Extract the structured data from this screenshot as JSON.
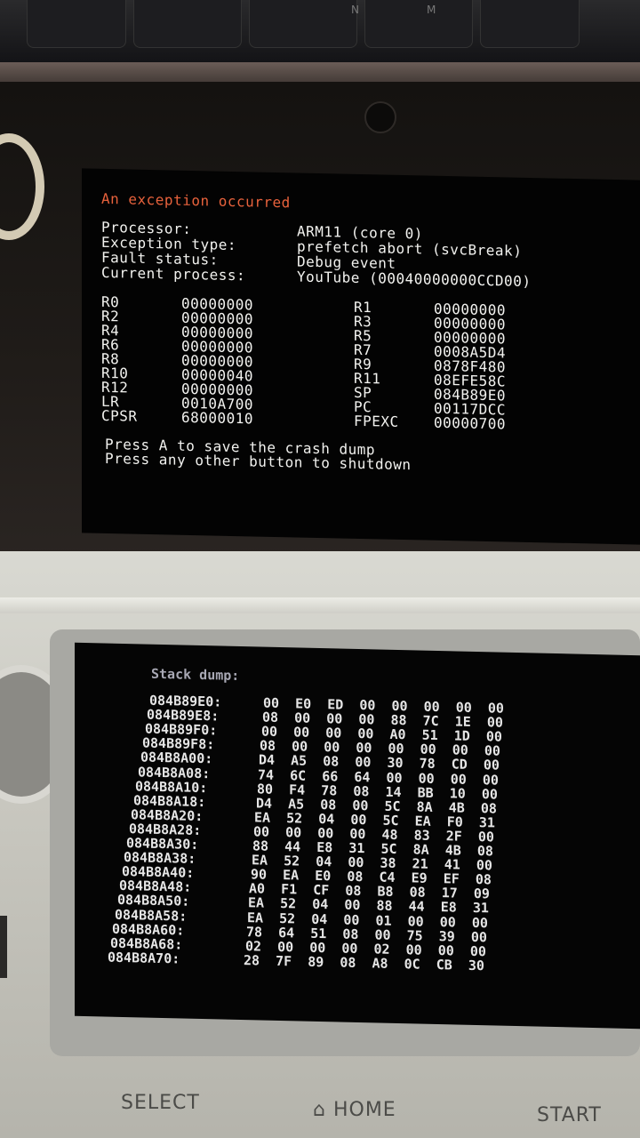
{
  "keyboard": {
    "letters": [
      "N",
      "M"
    ]
  },
  "top_screen": {
    "title": "An exception occurred",
    "info": [
      {
        "label": "Processor:",
        "value": "ARM11 (core 0)"
      },
      {
        "label": "Exception type:",
        "value": "prefetch abort (svcBreak)"
      },
      {
        "label": "Fault status:",
        "value": "Debug event"
      },
      {
        "label": "Current process:",
        "value": "YouTube (00040000000CCD00)"
      }
    ],
    "registers_left": [
      {
        "name": "R0",
        "value": "00000000"
      },
      {
        "name": "R2",
        "value": "00000000"
      },
      {
        "name": "R4",
        "value": "00000000"
      },
      {
        "name": "R6",
        "value": "00000000"
      },
      {
        "name": "R8",
        "value": "00000000"
      },
      {
        "name": "R10",
        "value": "00000040"
      },
      {
        "name": "R12",
        "value": "00000000"
      },
      {
        "name": "LR",
        "value": "0010A700"
      },
      {
        "name": "CPSR",
        "value": "68000010"
      }
    ],
    "registers_right": [
      {
        "name": "R1",
        "value": "00000000"
      },
      {
        "name": "R3",
        "value": "00000000"
      },
      {
        "name": "R5",
        "value": "00000000"
      },
      {
        "name": "R7",
        "value": "0008A5D4"
      },
      {
        "name": "R9",
        "value": "0878F480"
      },
      {
        "name": "R11",
        "value": "08EFE58C"
      },
      {
        "name": "SP",
        "value": "084B89E0"
      },
      {
        "name": "PC",
        "value": "00117DCC"
      },
      {
        "name": "FPEXC",
        "value": "00000700"
      }
    ],
    "prompt_save": "Press A to save the crash dump",
    "prompt_shutdown": "Press any other button to shutdown"
  },
  "bottom_screen": {
    "title": "Stack dump:",
    "rows": [
      {
        "addr": "084B89E0:",
        "bytes": "00  E0  ED  00  00  00  00  00"
      },
      {
        "addr": "084B89E8:",
        "bytes": "08  00  00  00  88  7C  1E  00"
      },
      {
        "addr": "084B89F0:",
        "bytes": "00  00  00  00  A0  51  1D  00"
      },
      {
        "addr": "084B89F8:",
        "bytes": "08  00  00  00  00  00  00  00"
      },
      {
        "addr": "084B8A00:",
        "bytes": "D4  A5  08  00  30  78  CD  00"
      },
      {
        "addr": "084B8A08:",
        "bytes": "74  6C  66  64  00  00  00  00"
      },
      {
        "addr": "084B8A10:",
        "bytes": "80  F4  78  08  14  BB  10  00"
      },
      {
        "addr": "084B8A18:",
        "bytes": "D4  A5  08  00  5C  8A  4B  08"
      },
      {
        "addr": "084B8A20:",
        "bytes": "EA  52  04  00  5C  EA  F0  31"
      },
      {
        "addr": "084B8A28:",
        "bytes": "00  00  00  00  48  83  2F  00"
      },
      {
        "addr": "084B8A30:",
        "bytes": "88  44  E8  31  5C  8A  4B  08"
      },
      {
        "addr": "084B8A38:",
        "bytes": "EA  52  04  00  38  21  41  00"
      },
      {
        "addr": "084B8A40:",
        "bytes": "90  EA  E0  08  C4  E9  EF  08"
      },
      {
        "addr": "084B8A48:",
        "bytes": "A0  F1  CF  08  B8  08  17  09"
      },
      {
        "addr": "084B8A50:",
        "bytes": "EA  52  04  00  88  44  E8  31"
      },
      {
        "addr": "084B8A58:",
        "bytes": "EA  52  04  00  01  00  00  00"
      },
      {
        "addr": "084B8A60:",
        "bytes": "78  64  51  08  00  75  39  00"
      },
      {
        "addr": "084B8A68:",
        "bytes": "02  00  00  00  02  00  00  00"
      },
      {
        "addr": "084B8A70:",
        "bytes": "28  7F  89  08  A8  0C  CB  30"
      }
    ]
  },
  "buttons": {
    "select": "SELECT",
    "home": "HOME",
    "start": "START"
  },
  "colors": {
    "title_red": "#e8623c",
    "screen_text": "#f2f2ef",
    "shell": "#d9d9d2"
  }
}
